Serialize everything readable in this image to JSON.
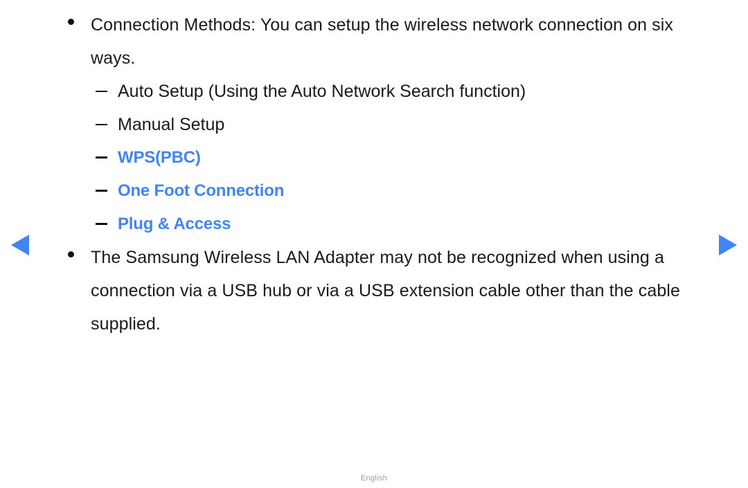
{
  "page": {
    "background_color": "#ffffff",
    "accent_color": "#4184f3",
    "text_color": "#1a1a1a"
  },
  "nav": {
    "prev_label": "◀",
    "next_label": "▶"
  },
  "content": {
    "blocks": [
      {
        "type": "bullet",
        "text": "Connection Methods: You can setup the wireless network connection on six ways."
      },
      {
        "type": "sub-list",
        "items": [
          {
            "label": "Auto Setup (Using the Auto Network Search function)",
            "accent": false
          },
          {
            "label": "Manual Setup",
            "accent": false
          },
          {
            "label": "WPS(PBC)",
            "accent": true
          },
          {
            "label": "One Foot Connection",
            "accent": true
          },
          {
            "label": "Plug & Access",
            "accent": true
          }
        ]
      },
      {
        "type": "bullet",
        "text": "The Samsung Wireless LAN Adapter may not be recognized when using a connection via a USB hub or via a USB extension cable other than the cable supplied."
      }
    ]
  },
  "footer": {
    "language": "English"
  }
}
